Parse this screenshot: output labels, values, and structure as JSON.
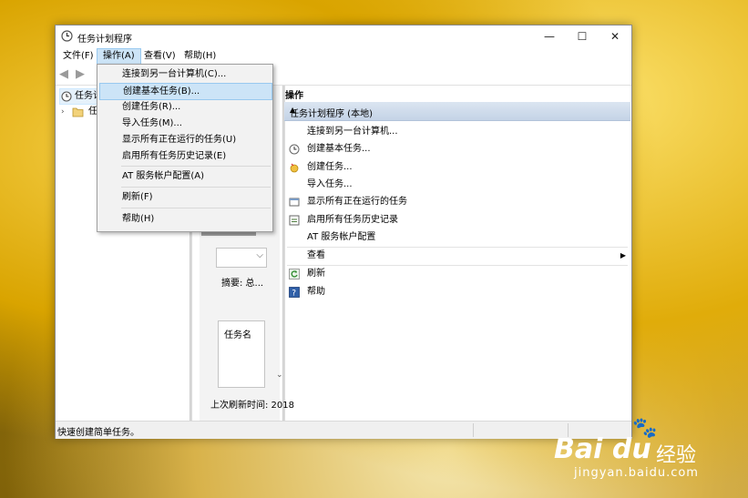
{
  "window": {
    "title": "任务计划程序",
    "controls": {
      "minimize": "—",
      "maximize": "☐",
      "close": "✕"
    }
  },
  "menubar": {
    "file": "文件(F)",
    "action": "操作(A)",
    "view": "查看(V)",
    "help": "帮助(H)"
  },
  "toolbar": {
    "back": "◀",
    "forward": "▶"
  },
  "tree": {
    "items": [
      {
        "label": "任务计"
      },
      {
        "label": "任"
      }
    ]
  },
  "middle": {
    "summary": "摘要: 总...",
    "list_header": "任务名",
    "last_refresh": "上次刷新时间: 2018"
  },
  "actions_pane": {
    "header": "操作",
    "section_title": "任务计划程序 (本地)",
    "items": [
      {
        "label": "连接到另一台计算机..."
      },
      {
        "label": "创建基本任务..."
      },
      {
        "label": "创建任务..."
      },
      {
        "label": "导入任务..."
      },
      {
        "label": "显示所有正在运行的任务"
      },
      {
        "label": "启用所有任务历史记录"
      },
      {
        "label": "AT 服务帐户配置"
      },
      {
        "label": "查看"
      },
      {
        "label": "刷新"
      },
      {
        "label": "帮助"
      }
    ]
  },
  "dropdown": {
    "items": [
      {
        "label": "连接到另一台计算机(C)..."
      },
      {
        "label": "创建基本任务(B)..."
      },
      {
        "label": "创建任务(R)..."
      },
      {
        "label": "导入任务(M)..."
      },
      {
        "label": "显示所有正在运行的任务(U)"
      },
      {
        "label": "启用所有任务历史记录(E)"
      },
      {
        "label": "AT 服务帐户配置(A)"
      },
      {
        "label": "刷新(F)"
      },
      {
        "label": "帮助(H)"
      }
    ],
    "highlighted_index": 1
  },
  "statusbar": {
    "text": "快速创建简单任务。"
  },
  "watermark": {
    "brand": "Bai  du",
    "sub": "经验",
    "url": "jingyan.baidu.com"
  },
  "colors": {
    "selection": "#cce4f7",
    "section_header": "#c4d3e6"
  }
}
